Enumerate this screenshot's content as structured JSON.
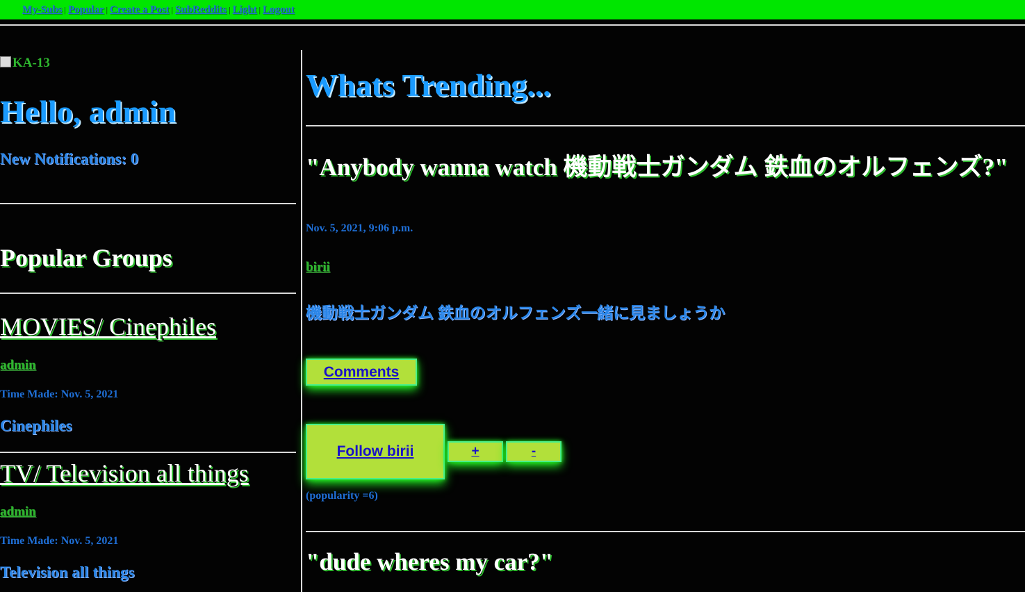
{
  "nav": {
    "items": [
      "My-Subs",
      "Popular",
      "Create a Post",
      "SubReddits",
      "Light",
      "Logout"
    ],
    "separator": "|"
  },
  "sidebar": {
    "avatar_alt": "KA-13",
    "greeting": "Hello, admin",
    "notifications": "New Notifications: 0",
    "popular_heading": "Popular Groups",
    "groups": [
      {
        "title": "MOVIES/ Cinephiles",
        "author": "admin",
        "time_made": "Time Made: Nov. 5, 2021",
        "description": "Cinephiles"
      },
      {
        "title": "TV/ Television all things",
        "author": "admin",
        "time_made": "Time Made: Nov. 5, 2021",
        "description": "Television all things"
      }
    ]
  },
  "main": {
    "heading": "Whats Trending...",
    "posts": [
      {
        "title": "\"Anybody wanna watch 機動戦士ガンダム 鉄血のオルフェンズ?\"",
        "date": "Nov. 5, 2021, 9:06 p.m.",
        "author": "birii",
        "body": "機動戦士ガンダム 鉄血のオルフェンズ一緒に見ましょうか",
        "comments_label": "Comments",
        "follow_label": "Follow birii",
        "upvote_label": "+",
        "downvote_label": "-",
        "popularity": "(popularity =6)"
      },
      {
        "title": "\"dude wheres my car?\""
      }
    ]
  },
  "colors": {
    "topbar": "#00e600",
    "background": "#030303",
    "accent_blue": "#1a9bff",
    "button_bg": "#b2e03a",
    "button_glow": "#22ee22"
  }
}
